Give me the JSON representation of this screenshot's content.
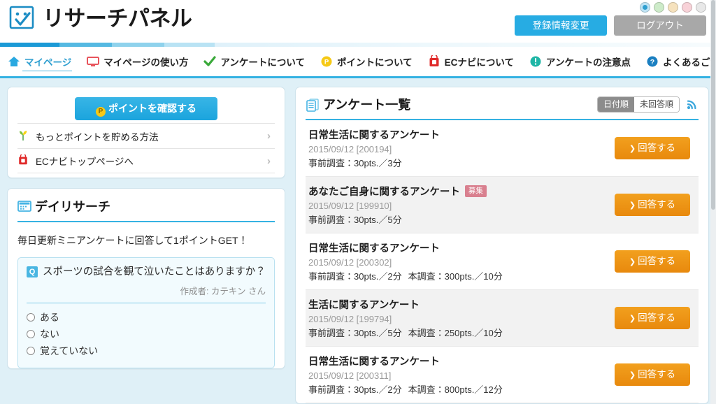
{
  "header": {
    "logo_text": "リサーチパネル",
    "logo_icon": "survey-check-logo",
    "register_label": "登録情報変更",
    "logout_label": "ログアウト",
    "theme_colors": [
      {
        "name": "blue",
        "hex": "#bfe4f5",
        "selected": true
      },
      {
        "name": "green",
        "hex": "#cdebc9",
        "selected": false
      },
      {
        "name": "orange",
        "hex": "#f6e2bd",
        "selected": false
      },
      {
        "name": "pink",
        "hex": "#f8d2d8",
        "selected": false
      },
      {
        "name": "gray",
        "hex": "#e8e8e8",
        "selected": false
      }
    ]
  },
  "nav": {
    "items": [
      {
        "label": "マイページ",
        "icon": "home-icon",
        "color": "#29a8e0",
        "active": true
      },
      {
        "label": "マイページの使い方",
        "icon": "monitor-icon",
        "color": "#e8545c",
        "active": false
      },
      {
        "label": "アンケートについて",
        "icon": "check-icon",
        "color": "#3aa93a",
        "active": false
      },
      {
        "label": "ポイントについて",
        "icon": "point-coin-icon",
        "color": "#f6c915",
        "active": false
      },
      {
        "label": "ECナビについて",
        "icon": "ecnavi-bag-icon",
        "color": "#e02b2b",
        "active": false
      },
      {
        "label": "アンケートの注意点",
        "icon": "warning-icon",
        "color": "#1fb6a6",
        "active": false
      },
      {
        "label": "よくあるご質問",
        "icon": "question-icon",
        "color": "#1a7fc1",
        "active": false
      }
    ]
  },
  "sidebar": {
    "points_button": "ポイントを確認する",
    "points_coin_glyph": "P",
    "links": [
      {
        "label": "もっとポイントを貯める方法",
        "icon": "leaf-icon",
        "chevron": "›"
      },
      {
        "label": "ECナビトップページへ",
        "icon": "ecnavi-bag-icon",
        "chevron": "›"
      }
    ]
  },
  "daily_research": {
    "title": "デイリサーチ",
    "icon": "calendar-icon",
    "lead": "毎日更新ミニアンケートに回答して1ポイントGET！",
    "question_badge": "Q",
    "question": "スポーツの試合を観て泣いたことはありますか？",
    "author": "作成者: カテキン さん",
    "options": [
      "ある",
      "ない",
      "覚えていない"
    ]
  },
  "survey_list": {
    "title": "アンケート一覧",
    "icon": "documents-icon",
    "sort_toggle": {
      "selected": "日付順",
      "options": [
        "日付順",
        "未回答順"
      ]
    },
    "rss_icon": "rss-icon",
    "answer_button_label": "回答する",
    "answer_button_arrow": "❯",
    "rows": [
      {
        "title": "日常生活に関するアンケート",
        "badge": "",
        "date": "2015/09/12 [200194]",
        "pre_survey": "事前調査：30pts.／3分",
        "main_survey": ""
      },
      {
        "title": "あなたご自身に関するアンケート",
        "badge": "募集",
        "date": "2015/09/12 [199910]",
        "pre_survey": "事前調査：30pts.／5分",
        "main_survey": ""
      },
      {
        "title": "日常生活に関するアンケート",
        "badge": "",
        "date": "2015/09/12 [200302]",
        "pre_survey": "事前調査：30pts.／2分",
        "main_survey": "本調査：300pts.／10分"
      },
      {
        "title": "生活に関するアンケート",
        "badge": "",
        "date": "2015/09/12 [199794]",
        "pre_survey": "事前調査：30pts.／5分",
        "main_survey": "本調査：250pts.／10分"
      },
      {
        "title": "日常生活に関するアンケート",
        "badge": "",
        "date": "2015/09/12 [200311]",
        "pre_survey": "事前調査：30pts.／2分",
        "main_survey": "本調査：800pts.／12分"
      }
    ]
  }
}
